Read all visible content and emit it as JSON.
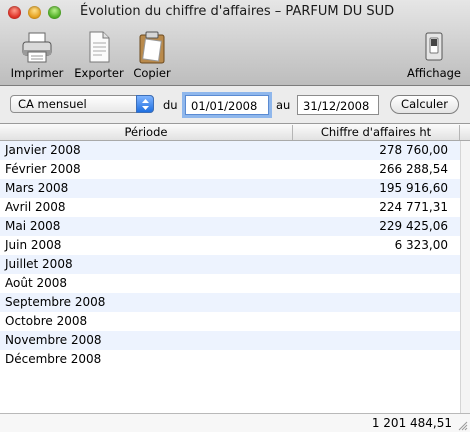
{
  "window": {
    "title": "Évolution du chiffre d'affaires – PARFUM DU SUD"
  },
  "toolbar": {
    "print_label": "Imprimer",
    "export_label": "Exporter",
    "copy_label": "Copier",
    "display_label": "Affichage",
    "icons": [
      "printer-icon",
      "document-icon",
      "clipboard-icon",
      "switch-icon"
    ]
  },
  "filter": {
    "period_type": "CA mensuel",
    "from_label": "du",
    "from_date": "01/01/2008",
    "to_label": "au",
    "to_date": "31/12/2008",
    "calculate_label": "Calculer"
  },
  "table": {
    "headers": [
      "Période",
      "Chiffre d'affaires ht"
    ],
    "rows": [
      {
        "period": "Janvier 2008",
        "value": "278 760,00"
      },
      {
        "period": "Février 2008",
        "value": "266 288,54"
      },
      {
        "period": "Mars 2008",
        "value": "195 916,60"
      },
      {
        "period": "Avril 2008",
        "value": "224 771,31"
      },
      {
        "period": "Mai 2008",
        "value": "229 425,06"
      },
      {
        "period": "Juin 2008",
        "value": "6 323,00"
      },
      {
        "period": "Juillet 2008",
        "value": ""
      },
      {
        "period": "Août 2008",
        "value": ""
      },
      {
        "period": "Septembre 2008",
        "value": ""
      },
      {
        "period": "Octobre 2008",
        "value": ""
      },
      {
        "period": "Novembre 2008",
        "value": ""
      },
      {
        "period": "Décembre 2008",
        "value": ""
      }
    ],
    "total": "1 201 484,51"
  },
  "colors": {
    "row_stripe": "#edf3fe",
    "focus_ring": "#8fb7ec",
    "select_arrow": "#1e6fe0"
  }
}
